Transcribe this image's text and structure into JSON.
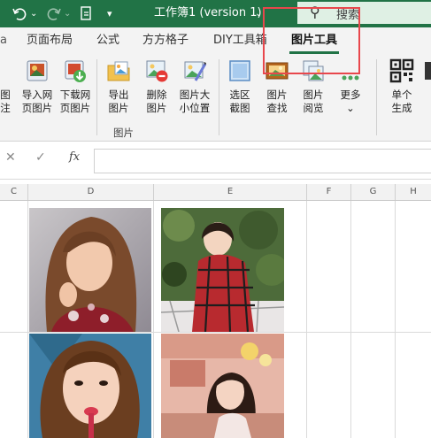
{
  "titlebar": {
    "title": "工作簿1 (version 1)",
    "dropdown_icon": "chevron-down-icon",
    "search_label": "搜索",
    "undo_icon": "undo-icon",
    "redo_icon": "redo-icon",
    "quick_icon": "document-icon"
  },
  "tabs": [
    {
      "label": "页面布局"
    },
    {
      "label": "公式"
    },
    {
      "label": "方方格子"
    },
    {
      "label": "DIY工具箱"
    },
    {
      "label": "图片工具",
      "active": true
    }
  ],
  "ribbon": {
    "buttons": [
      {
        "label": "导入网\n页图片",
        "icon": "import-web-image-icon"
      },
      {
        "label": "下载网\n页图片",
        "icon": "download-web-image-icon"
      },
      {
        "label": "导出\n图片",
        "icon": "export-image-icon"
      },
      {
        "label": "删除\n图片",
        "icon": "delete-image-icon"
      },
      {
        "label": "图片大\n小位置",
        "icon": "image-size-position-icon"
      },
      {
        "label": "选区\n截图",
        "icon": "selection-screenshot-icon"
      },
      {
        "label": "图片\n查找",
        "icon": "image-find-icon"
      },
      {
        "label": "图片\n阅览",
        "icon": "image-preview-icon"
      },
      {
        "label": "更多\n⌄",
        "icon": "more-icon"
      },
      {
        "label": "单个\n生成",
        "icon": "qr-code-icon"
      }
    ],
    "group_label": "图片",
    "partial_left_label_1": "图",
    "partial_left_label_2": "注"
  },
  "formula_bar": {
    "cancel": "✕",
    "confirm": "✓",
    "fx": "fx",
    "value": ""
  },
  "columns": [
    "C",
    "D",
    "E",
    "F",
    "G",
    "H"
  ],
  "colors": {
    "accent": "#217346",
    "highlight": "#e8474c"
  }
}
